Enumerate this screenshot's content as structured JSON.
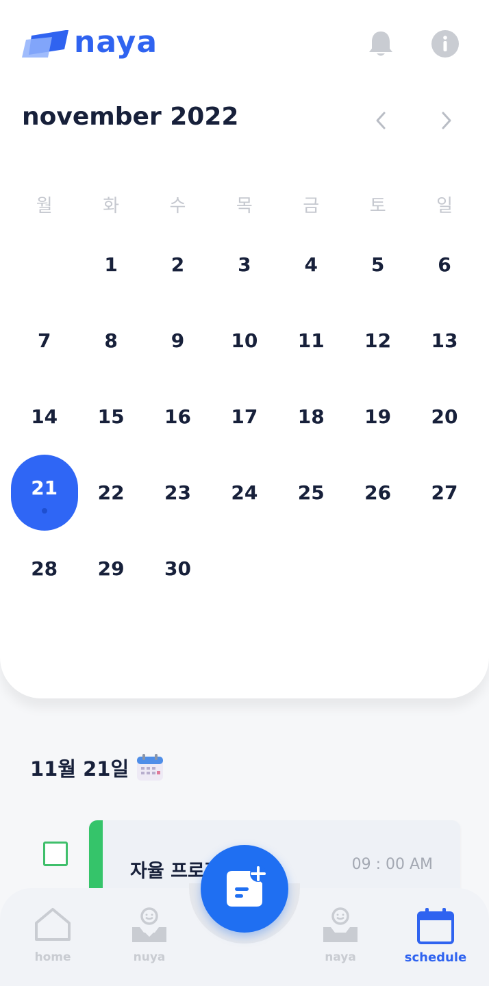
{
  "header": {
    "logo_text": "naya",
    "icons": [
      "bell-icon",
      "info-icon"
    ]
  },
  "calendar": {
    "month_title": "november 2022",
    "weekdays": [
      "월",
      "화",
      "수",
      "목",
      "금",
      "토",
      "일"
    ],
    "weeks": [
      [
        "",
        "1",
        "2",
        "3",
        "4",
        "5",
        "6"
      ],
      [
        "7",
        "8",
        "9",
        "10",
        "11",
        "12",
        "13"
      ],
      [
        "14",
        "15",
        "16",
        "17",
        "18",
        "19",
        "20"
      ],
      [
        "21",
        "22",
        "23",
        "24",
        "25",
        "26",
        "27"
      ],
      [
        "28",
        "29",
        "30",
        "",
        "",
        "",
        ""
      ]
    ],
    "selected_day": "21",
    "accent_color": "#2f66f5"
  },
  "schedule": {
    "date_heading": "11월 21일",
    "tasks": [
      {
        "title": "자율 프로젝트 발표",
        "time": "09 : 00 AM",
        "checked": false,
        "color": "#35c46a"
      }
    ]
  },
  "bottom_nav": {
    "home": "home",
    "nuya": "nuya",
    "naya": "naya",
    "schedule": "schedule",
    "active": "schedule",
    "fab_icon": "add-note-icon"
  }
}
